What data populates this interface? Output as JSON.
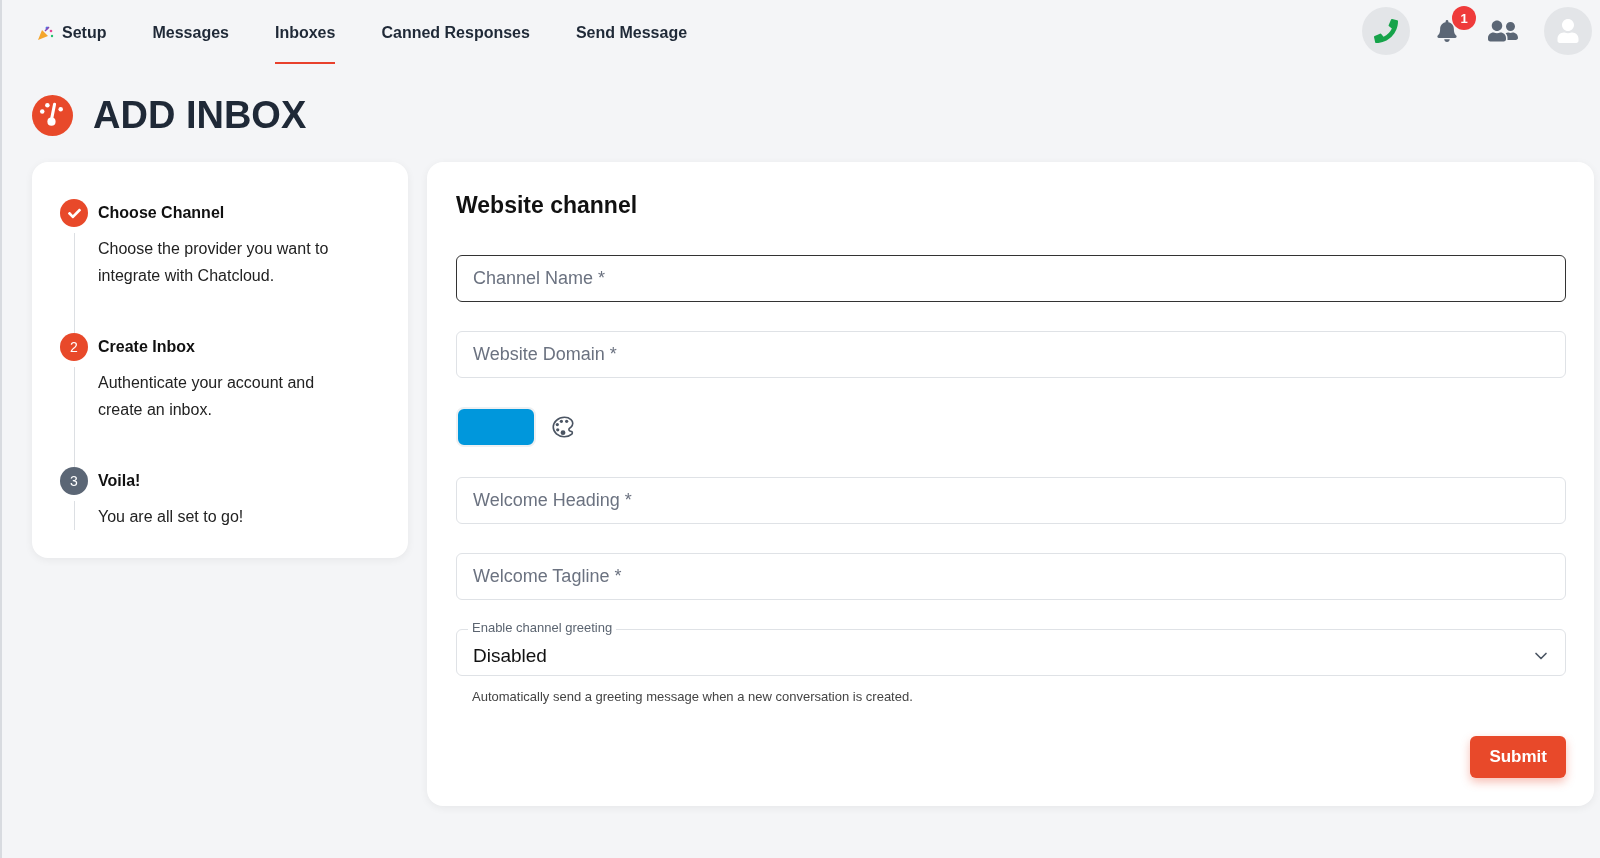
{
  "nav": {
    "items": [
      {
        "label": "Setup",
        "selected": false,
        "icon": true
      },
      {
        "label": "Messages",
        "selected": false
      },
      {
        "label": "Inboxes",
        "selected": true
      },
      {
        "label": "Canned Responses",
        "selected": false
      },
      {
        "label": "Send Message",
        "selected": false
      }
    ],
    "notification_count": "1"
  },
  "page_title": "ADD INBOX",
  "steps": [
    {
      "title": "Choose Channel",
      "done": true,
      "description": "Choose the provider you want to integrate with Chatcloud."
    },
    {
      "title": "Create Inbox",
      "number": "2",
      "done": false,
      "current": true,
      "description": "Authenticate your account and create an inbox."
    },
    {
      "title": "Voila!",
      "number": "3",
      "done": false,
      "current": false,
      "description": "You are all set to go!"
    }
  ],
  "form": {
    "title": "Website channel",
    "fields": [
      {
        "kind": "text",
        "placeholder": "Channel Name *",
        "focused": true
      },
      {
        "kind": "text",
        "placeholder": "Website Domain *",
        "focused": false
      },
      {
        "kind": "color",
        "color": "#0097dc"
      },
      {
        "kind": "text",
        "placeholder": "Welcome Heading *",
        "focused": false
      },
      {
        "kind": "text",
        "placeholder": "Welcome Tagline *",
        "focused": false
      },
      {
        "kind": "select",
        "label": "Enable channel greeting",
        "value": "Disabled",
        "help": "Automatically send a greeting message when a new conversation is created."
      }
    ],
    "submit": "Submit"
  }
}
